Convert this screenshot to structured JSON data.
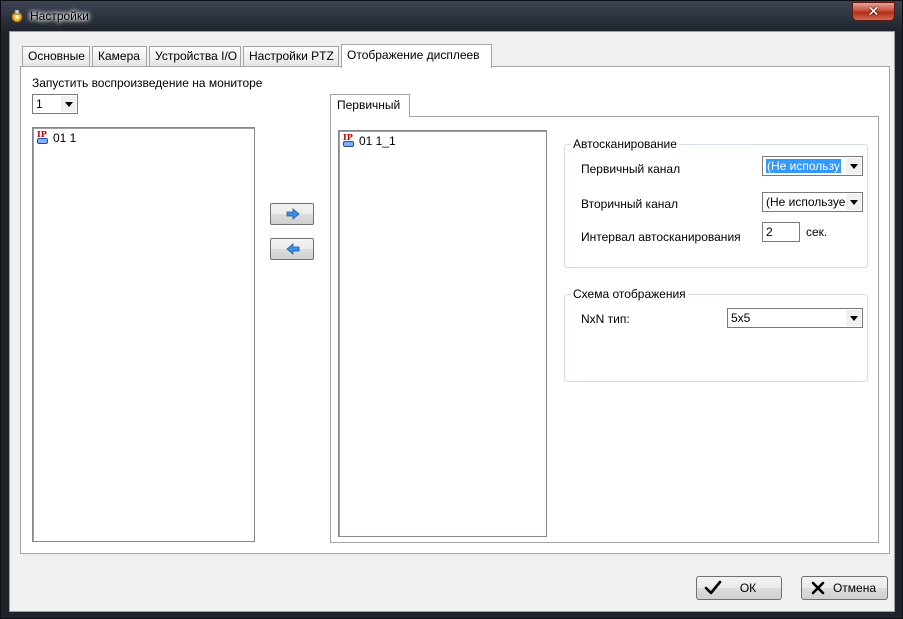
{
  "window": {
    "title": "Настройки",
    "close_label": "✕"
  },
  "tabs": [
    {
      "label": "Основные",
      "active": false
    },
    {
      "label": "Камера",
      "active": false
    },
    {
      "label": "Устройства I/O",
      "active": false
    },
    {
      "label": "Настройки PTZ",
      "active": false
    },
    {
      "label": "Отображение дисплеев",
      "active": true
    }
  ],
  "monitor": {
    "label": "Запустить воспроизведение на мониторе",
    "selected": "1"
  },
  "source_list": {
    "items": [
      {
        "badge": "IP",
        "label": "01 1"
      }
    ]
  },
  "subtab": {
    "label": "Первичный"
  },
  "target_list": {
    "items": [
      {
        "badge": "IP",
        "label": "01 1_1"
      }
    ]
  },
  "autoscan": {
    "legend": "Автосканирование",
    "primary_label": "Первичный канал",
    "primary_value": "(Не использу",
    "secondary_label": "Вторичный канал",
    "secondary_value": "(Не используе",
    "interval_label": "Интервал автосканирования",
    "interval_value": "2",
    "interval_unit": "сек."
  },
  "layout": {
    "legend": "Схема отображения",
    "type_label": "NxN тип:",
    "type_value": "5x5"
  },
  "buttons": {
    "ok": "ОК",
    "cancel": "Отмена"
  }
}
